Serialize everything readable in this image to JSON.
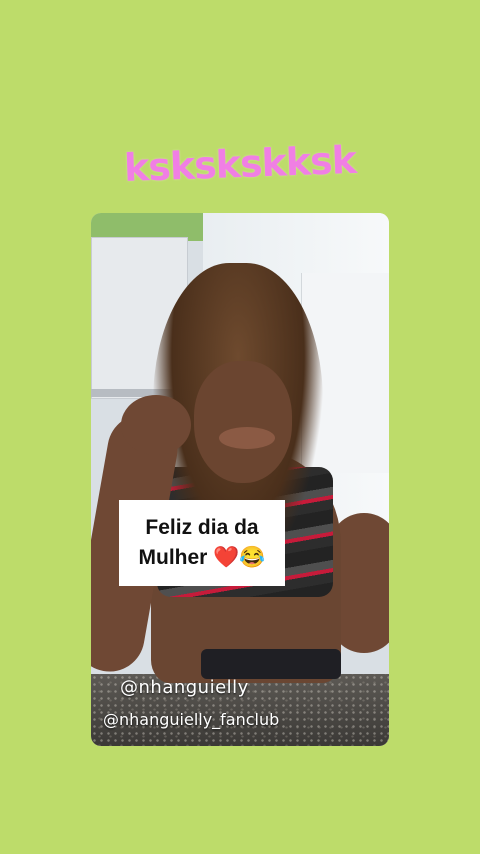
{
  "story": {
    "sticker_text": "kskskskksk",
    "caption_line1": "Feliz dia da",
    "caption_line2": "Mulher",
    "caption_emojis": "❤️😂",
    "handle_primary": "@nhanguielly",
    "handle_secondary": "@nhanguielly_fanclub"
  },
  "colors": {
    "background": "#bddc6a",
    "sticker_text": "#f07fe4",
    "caption_bg": "#ffffff"
  }
}
